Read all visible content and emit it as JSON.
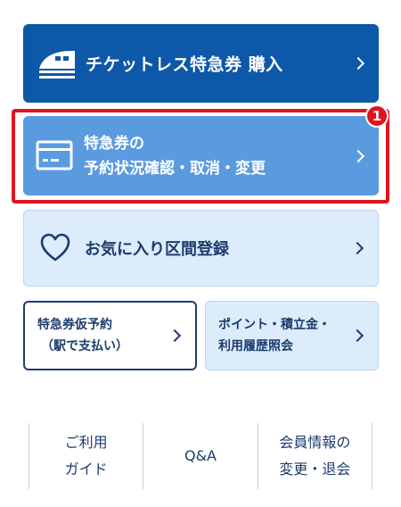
{
  "menu": {
    "purchase": {
      "label": "チケットレス特急券 購入",
      "icon": "train-icon"
    },
    "status": {
      "line1": "特急券の",
      "line2": "予約状況確認・取消・変更",
      "icon": "card-icon"
    },
    "favorite": {
      "label": "お気に入り区間登録",
      "icon": "heart-icon"
    },
    "provisional": {
      "line1": "特急券仮予約",
      "line2": "（駅で支払い）"
    },
    "points": {
      "line1": "ポイント・積立金・",
      "line2": "利用履歴照会"
    }
  },
  "badge": {
    "text": "1"
  },
  "footer": {
    "guide": {
      "line1": "ご利用",
      "line2": "ガイド"
    },
    "qa": {
      "label": "Q&A"
    },
    "member": {
      "line1": "会員情報の",
      "line2": "変更・退会"
    }
  },
  "colors": {
    "primary": "#0d58a8",
    "secondary": "#5a9be0",
    "light": "#dcecfb",
    "highlight": "#e0141e",
    "text": "#1d3c6e"
  }
}
